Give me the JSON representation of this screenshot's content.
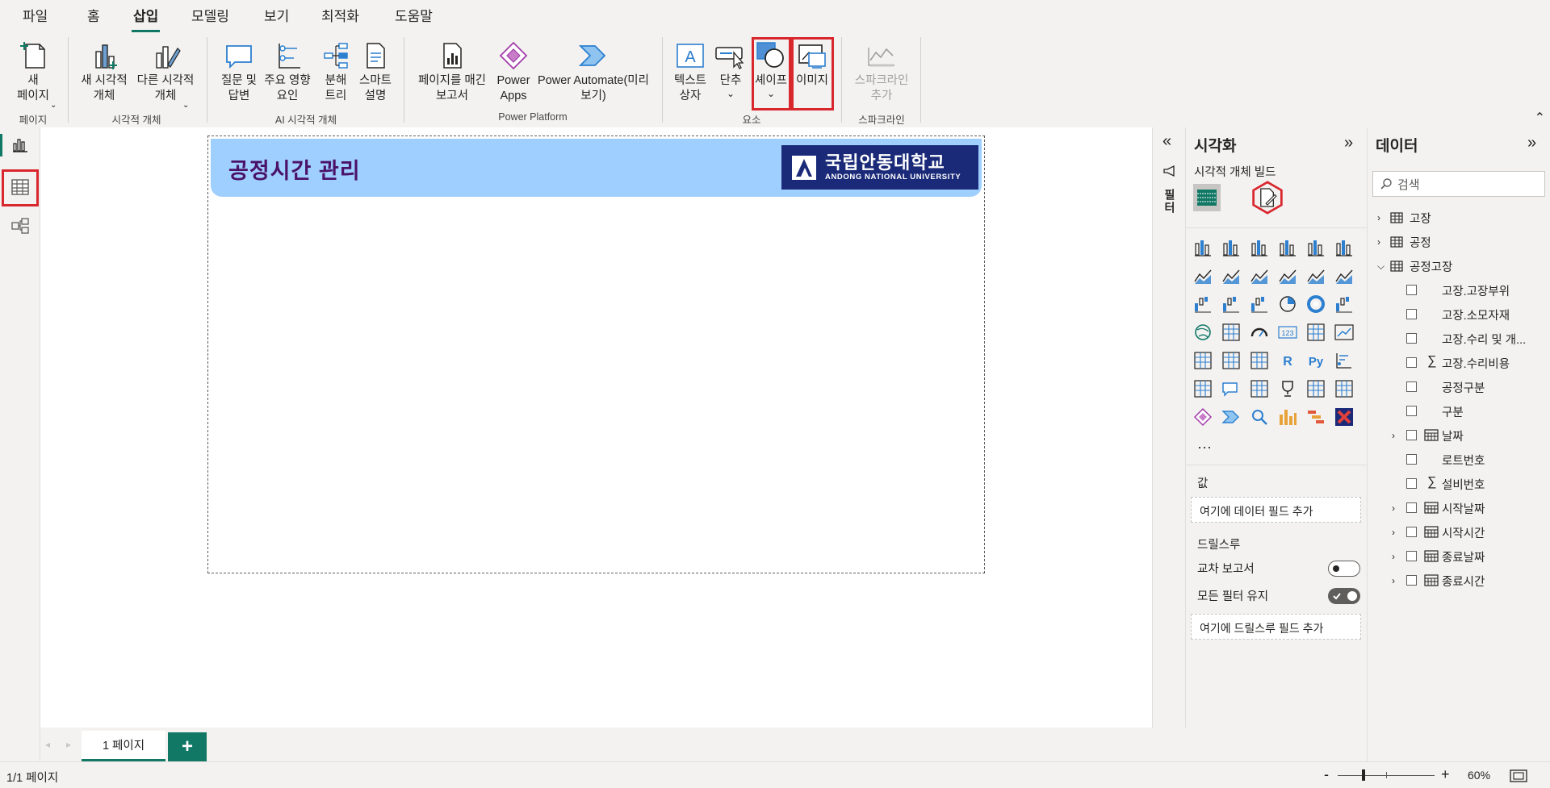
{
  "menu": {
    "items": [
      "파일",
      "홈",
      "삽입",
      "모델링",
      "보기",
      "최적화",
      "도움말"
    ],
    "active": "삽입"
  },
  "ribbon": {
    "buttons": {
      "new_page": "새\n페이지",
      "new_visual": "새 시각적\n개체",
      "other_visual": "다른 시각적\n개체",
      "qna": "질문 및\n답변",
      "key_influencers": "주요 영향\n요인",
      "decomp_tree": "분해\n트리",
      "smart_narrative": "스마트\n설명",
      "paginated_report": "페이지를 매긴\n보고서",
      "power_apps": "Power\nApps",
      "power_automate": "Power Automate(미리\n보기)",
      "text_box": "텍스트\n상자",
      "buttons": "단추",
      "shapes": "셰이프",
      "image": "이미지",
      "sparkline": "스파크라인\n추가"
    },
    "groups": {
      "page": "페이지",
      "visuals": "시각적 개체",
      "ai_visuals": "AI 시각적 개체",
      "power_platform": "Power Platform",
      "elements": "요소",
      "sparklines": "스파크라인"
    }
  },
  "canvas": {
    "banner_title": "공정시간 관리",
    "logo_kr": "국립안동대학교",
    "logo_en": "ANDONG NATIONAL UNIVERSITY"
  },
  "page_tabs": {
    "tab_label": "1 페이지",
    "add_label": "+"
  },
  "status": {
    "page_info": "1/1 페이지",
    "zoom_minus": "-",
    "zoom_plus": "+",
    "zoom_level": "60%"
  },
  "filters": {
    "label": "필터"
  },
  "visualizations": {
    "title": "시각화",
    "subtitle": "시각적 개체 빌드",
    "more": "···",
    "values_label": "값",
    "values_placeholder": "여기에 데이터 필드 추가",
    "drillthrough_label": "드릴스루",
    "cross_report_label": "교차 보고서",
    "cross_report_state": "off",
    "keep_filters_label": "모든 필터 유지",
    "keep_filters_state": "on",
    "drill_placeholder": "여기에 드릴스루 필드 추가"
  },
  "data": {
    "title": "데이터",
    "search_placeholder": "검색",
    "tables": [
      {
        "name": "고장",
        "expanded": false
      },
      {
        "name": "공정",
        "expanded": false
      },
      {
        "name": "공정고장",
        "expanded": true
      }
    ],
    "fields": [
      {
        "name": "고장.고장부위",
        "icon": "none",
        "expandable": false
      },
      {
        "name": "고장.소모자재",
        "icon": "none",
        "expandable": false
      },
      {
        "name": "고장.수리 및 개...",
        "icon": "none",
        "expandable": false
      },
      {
        "name": "고장.수리비용",
        "icon": "sigma",
        "expandable": false
      },
      {
        "name": "공정구분",
        "icon": "none",
        "expandable": false
      },
      {
        "name": "구분",
        "icon": "none",
        "expandable": false
      },
      {
        "name": "날짜",
        "icon": "calendar",
        "expandable": true
      },
      {
        "name": "로트번호",
        "icon": "none",
        "expandable": false
      },
      {
        "name": "설비번호",
        "icon": "sigma",
        "expandable": false
      },
      {
        "name": "시작날짜",
        "icon": "calendar",
        "expandable": true
      },
      {
        "name": "시작시간",
        "icon": "calendar",
        "expandable": true
      },
      {
        "name": "종료날짜",
        "icon": "calendar",
        "expandable": true
      },
      {
        "name": "종료시간",
        "icon": "calendar",
        "expandable": true
      }
    ]
  },
  "colors": {
    "accent": "#117865",
    "highlight": "#d9272e",
    "banner": "#9fcfff",
    "banner_title": "#4a1269",
    "logo_bg": "#1a2a78"
  }
}
